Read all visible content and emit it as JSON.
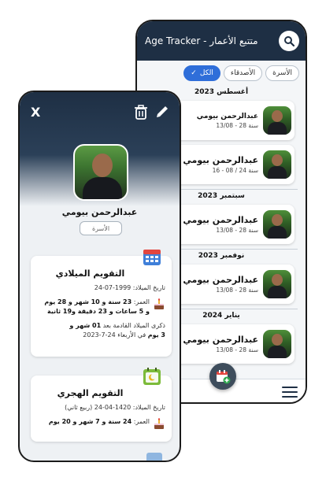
{
  "back_screen": {
    "title": "Age Tracker - متتبع الأعمار",
    "filters": [
      {
        "label": "الكل",
        "active": true
      },
      {
        "label": "الأصدقاء",
        "active": false
      },
      {
        "label": "الأسرة",
        "active": false
      }
    ],
    "groups": [
      {
        "month": "أغسطس 2023",
        "entries": [
          {
            "name": "عبدالرحمن بيومي",
            "meta": "13/08 - 28 سنة"
          },
          {
            "name": "عبدالرحمن بيومي",
            "meta": "16 - 08 / 24 سنة"
          }
        ]
      },
      {
        "month": "سبتمبر 2023",
        "entries": [
          {
            "name": "عبدالرحمن بيومي",
            "meta": "13/08 - 28 سنة"
          }
        ]
      },
      {
        "month": "نوفمبر 2023",
        "entries": [
          {
            "name": "عبدالرحمن بيومي",
            "meta": "13/08 - 28 سنة"
          }
        ]
      },
      {
        "month": "يناير 2024",
        "entries": [
          {
            "name": "عبدالرحمن بيومي",
            "meta": "13/08 - 28 سنة"
          }
        ]
      }
    ]
  },
  "front_screen": {
    "close_label": "X",
    "name": "عبدالرحمن بيومي",
    "tag": "الأسرة",
    "gregorian": {
      "title": "التقويم الميلادي",
      "birth_label": "تاريخ الميلاد:",
      "birth_value": "1999-07-24",
      "age_label": "العمر:",
      "age_line1": "23 سنة و 10 شهر و 28 يوم",
      "age_line2": "و 5 ساعات و 23 دقيقة و19 ثانية",
      "next_label": "ذكرى الميلاد القادمة بعد",
      "next_value": "01 شهر و",
      "next_value2": "3 يوم",
      "next_date": "في الأربعاء 24-7-2023"
    },
    "hijri": {
      "title": "التقويم الهجري",
      "birth_label": "تاريخ الميلاد:",
      "birth_value": "1420-04-24 (ربيع ثاني)",
      "age_label": "العمر:",
      "age_value": "24 سنة و 7 شهر و 20 يوم"
    }
  },
  "colors": {
    "header": "#1e2f44",
    "accent": "#2f6ed9",
    "bg": "#eef1f4"
  },
  "icons": [
    "search-icon",
    "check-icon",
    "menu-icon",
    "calendar-add-icon",
    "close-icon",
    "trash-icon",
    "pencil-icon",
    "calendar-icon",
    "crescent-calendar-icon",
    "cake-icon"
  ]
}
